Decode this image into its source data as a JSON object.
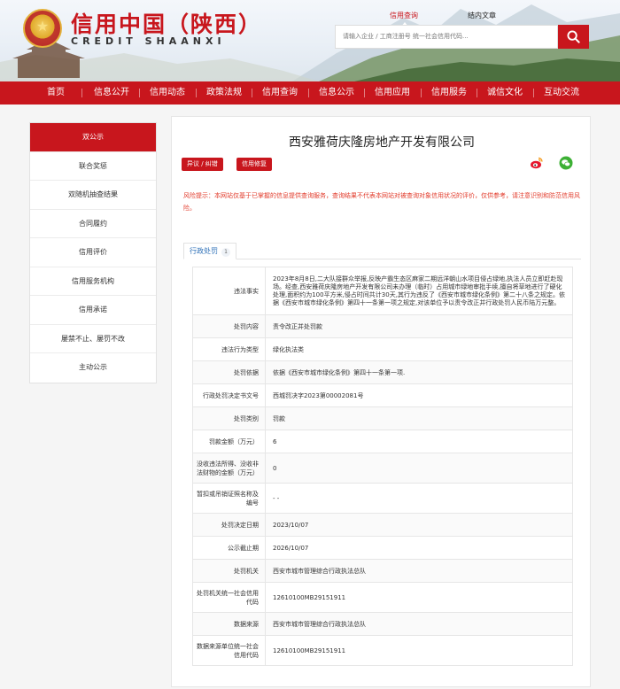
{
  "site": {
    "title": "信用中国（陕西）",
    "subtitle": "CREDIT SHAANXI"
  },
  "search": {
    "tabs": [
      "信用查询",
      "结内文章"
    ],
    "placeholder": "请输入企业 / 工商注册号 统一社会信用代码..."
  },
  "nav": [
    "首页",
    "信息公开",
    "信用动态",
    "政策法规",
    "信用查询",
    "信息公示",
    "信用应用",
    "信用服务",
    "诚信文化",
    "互动交流"
  ],
  "sidebar": [
    "双公示",
    "联合奖惩",
    "双随机抽查结果",
    "合同履约",
    "信用评价",
    "信用服务机构",
    "信用承诺",
    "屡禁不止、屡罚不改",
    "主动公示"
  ],
  "main": {
    "company": "西安雅荷庆隆房地产开发有限公司",
    "objection_button": "异议 / 纠错",
    "repair_button": "信用修复",
    "risk_notice": "风险提示：本网站仅基于已掌握的信息提供查询服务，查询结果不代表本网站对被查询对象信用状况的评价，仅供参考，请注意识别和防范信用风险。",
    "tab_label": "行政处罚",
    "tab_count": "1"
  },
  "details": [
    {
      "label": "违法事实",
      "value": "2023年8月8日,二大队接群众举报,反映产霸生态区麻家二期远洋朝山水项目侵占绿地,执法人员立即赶赴现场。经查,西安雅荷庆隆房地产开发有限公司未办理（临时）占用城市绿地审批手续,擅自将草地进行了硬化处理,面积约为100平方米,侵占时间共计30天,其行为违反了《西安市城市绿化条例》第二十八条之规定。依据《西安市城市绿化条例》第四十一条第一项之规定,对该单位予以责令改正并行政处罚人民币陆万元整。"
    },
    {
      "label": "处罚内容",
      "value": "责令改正并处罚款"
    },
    {
      "label": "违法行为类型",
      "value": "绿化执法类"
    },
    {
      "label": "处罚依据",
      "value": "依据《西安市城市绿化条例》第四十一条第一项."
    },
    {
      "label": "行政处罚决定书文号",
      "value": "西城罚决字2023第00002081号"
    },
    {
      "label": "处罚类别",
      "value": "罚款"
    },
    {
      "label": "罚款金额（万元）",
      "value": "6"
    },
    {
      "label": "没收违法所得、没收非法财物的金额（万元）",
      "value": "0"
    },
    {
      "label": "暂扣或吊销证照名称及编号",
      "value": "- -"
    },
    {
      "label": "处罚决定日期",
      "value": "2023/10/07"
    },
    {
      "label": "公示截止期",
      "value": "2026/10/07"
    },
    {
      "label": "处罚机关",
      "value": "西安市城市管理综合行政执法总队"
    },
    {
      "label": "处罚机关统一社会信用代码",
      "value": "12610100MB29151911"
    },
    {
      "label": "数据来源",
      "value": "西安市城市管理综合行政执法总队"
    },
    {
      "label": "数据来源单位统一社会信用代码",
      "value": "12610100MB29151911"
    }
  ],
  "colors": {
    "brand_red": "#c8161d",
    "risk_red": "#e23b2b",
    "tab_blue": "#2c6fb7"
  }
}
